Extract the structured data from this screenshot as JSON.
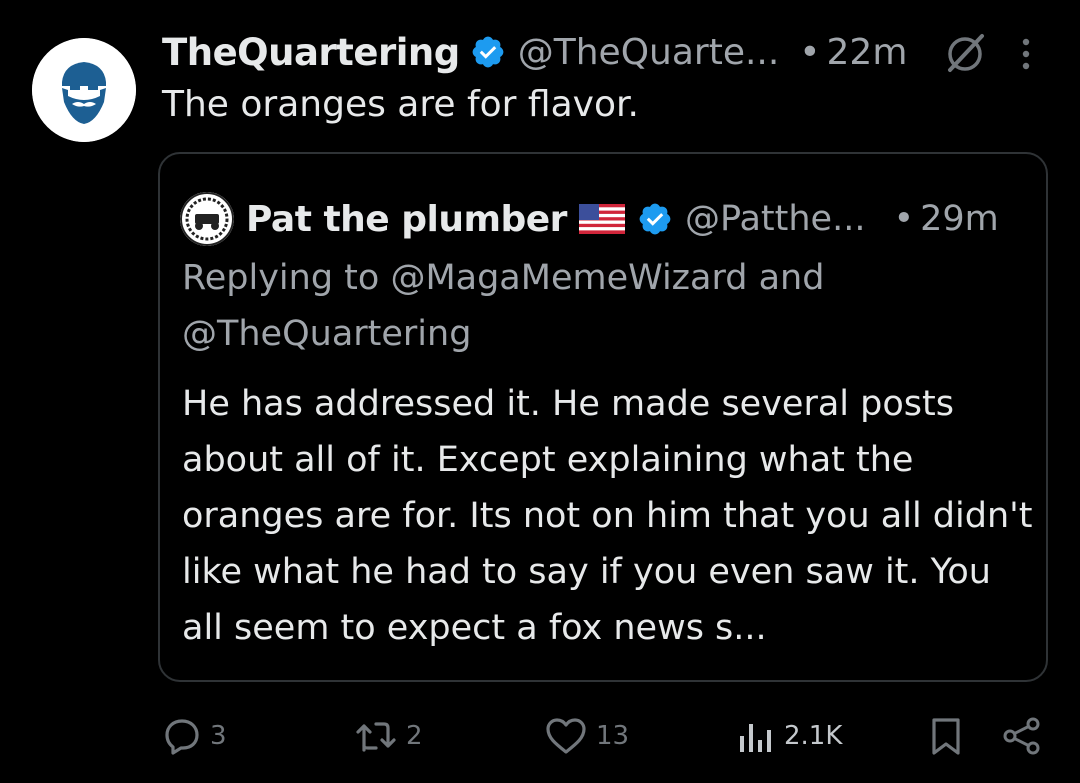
{
  "post": {
    "author_name": "TheQuartering",
    "author_handle": "@TheQuarte...",
    "separator": "•",
    "time": "22m",
    "text": "The oranges are for flavor."
  },
  "quoted_post": {
    "author_name": "Pat the plumber",
    "author_handle": "@Patthe...",
    "separator": "•",
    "time": "29m",
    "replying_to": "Replying to @MagaMemeWizard and @TheQuartering",
    "text": "He has addressed it. He made several posts about all of it. Except explaining what the oranges are for.  Its not on him that you all didn't like what he had to say if you even saw it.  You all seem to expect a fox news s..."
  },
  "actions": {
    "replies": "3",
    "reposts": "2",
    "likes": "13",
    "views": "2.1K"
  },
  "icons": {
    "verified": "verified-badge-icon",
    "grok": "grok-icon",
    "more": "more-vertical-icon",
    "reply": "reply-icon",
    "repost": "repost-icon",
    "like": "heart-icon",
    "views": "views-icon",
    "bookmark": "bookmark-icon",
    "share": "share-icon"
  },
  "colors": {
    "background": "#000000",
    "text_primary": "#e7e9ea",
    "text_secondary": "#a0a5ab",
    "verified_blue": "#1d9bf0",
    "border": "#2f3336",
    "avatar_blue": "#1d5f93"
  }
}
